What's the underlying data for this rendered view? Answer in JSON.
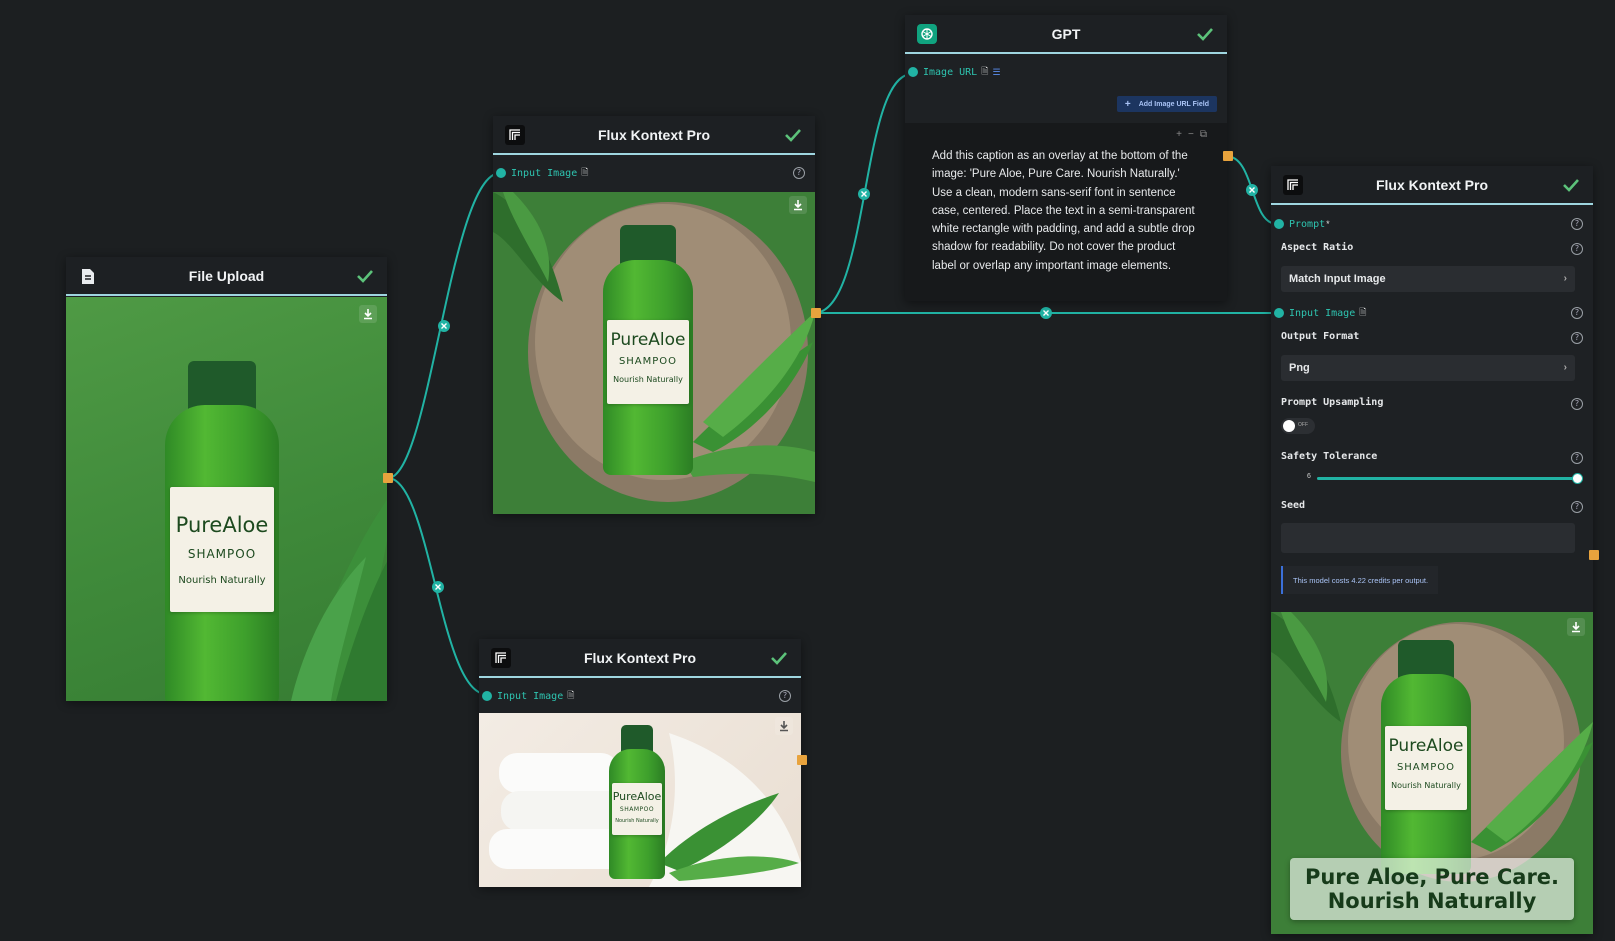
{
  "nodes": {
    "file_upload": {
      "title": "File Upload"
    },
    "flux1": {
      "title": "Flux Kontext Pro",
      "input_label": "Input Image",
      "product": {
        "brand": "PureAloe",
        "type": "SHAMPOO",
        "tagline": "Nourish Naturally"
      }
    },
    "flux2": {
      "title": "Flux Kontext Pro",
      "input_label": "Input Image",
      "product": {
        "brand": "PureAloe",
        "type": "SHAMPOO",
        "tagline": "Nourish Naturally"
      }
    },
    "gpt": {
      "title": "GPT",
      "image_url_label": "Image URL",
      "add_button": "Add Image URL Field",
      "prompt_text": "Add this caption as an overlay at the bottom of the image: 'Pure Aloe, Pure Care. Nourish Naturally.' Use a clean, modern sans-serif font in sentence case, centered. Place the text in a semi-transparent white rectangle with padding, and add a subtle drop shadow for readability. Do not cover the product label or overlap any important image elements."
    },
    "flux3": {
      "title": "Flux Kontext Pro",
      "prompt_label": "Prompt",
      "prompt_required": "*",
      "aspect_ratio_label": "Aspect Ratio",
      "aspect_ratio_value": "Match Input Image",
      "input_label": "Input Image",
      "output_format_label": "Output Format",
      "output_format_value": "Png",
      "upsampling_label": "Prompt Upsampling",
      "upsampling_toggle": "OFF",
      "upsampling_on": false,
      "safety_label": "Safety Tolerance",
      "safety_value": "6",
      "safety_fraction": 1.0,
      "seed_label": "Seed",
      "seed_value": "",
      "cost_note": "This model costs 4.22 credits per output.",
      "product": {
        "brand": "PureAloe",
        "type": "SHAMPOO",
        "tagline": "Nourish Naturally"
      },
      "overlay_line1": "Pure Aloe, Pure Care.",
      "overlay_line2": "Nourish Naturally"
    },
    "file_upload_product": {
      "brand": "PureAloe",
      "type": "SHAMPOO",
      "tagline": "Nourish Naturally"
    }
  },
  "colors": {
    "wire": "#21b3a4",
    "port_out": "#e8a33d",
    "check": "#5cc27a",
    "header_underline": "#9fd6e0",
    "accent_blue": "#3b6fd8"
  }
}
